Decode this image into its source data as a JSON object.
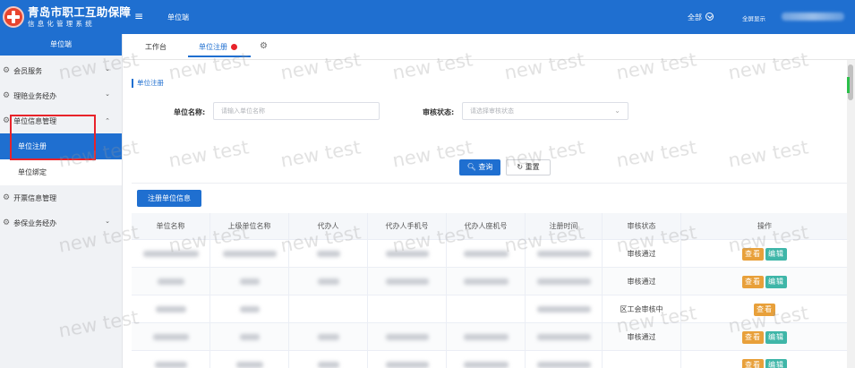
{
  "colors": {
    "primary": "#1f6fd0",
    "danger": "#e8232a",
    "view_btn": "#e8a03a",
    "edit_btn": "#3fb6a8"
  },
  "header": {
    "logo_title": "青岛市职工互助保障",
    "logo_subtitle": "信息化管理系统",
    "menu_icon": "menu-icon",
    "page_title": "单位端",
    "all_label": "全部",
    "fullscreen_label": "全屏显示"
  },
  "sidebar": {
    "title": "单位端",
    "items": [
      {
        "label": "会员服务",
        "icon": "gear-icon",
        "chevron": "chevron-down-icon"
      },
      {
        "label": "理赔业务经办",
        "icon": "gear-icon",
        "chevron": "chevron-down-icon"
      },
      {
        "label": "单位信息管理",
        "icon": "gear-icon",
        "chevron": "chevron-up-icon",
        "children": [
          {
            "label": "单位注册",
            "active": true
          },
          {
            "label": "单位绑定"
          }
        ]
      },
      {
        "label": "开票信息管理",
        "icon": "gear-icon"
      },
      {
        "label": "参保业务经办",
        "icon": "gear-icon",
        "chevron": "chevron-down-icon"
      }
    ]
  },
  "tabs": [
    {
      "label": "工作台"
    },
    {
      "label": "单位注册",
      "active": true
    }
  ],
  "section_title": "单位注册",
  "search": {
    "name_label": "单位名称:",
    "name_placeholder": "请输入单位名称",
    "status_label": "审核状态:",
    "status_placeholder": "请选择审核状态",
    "search_button": "查询",
    "reset_button": "重置"
  },
  "register_button": "注册单位信息",
  "table": {
    "columns": [
      "单位名称",
      "上级单位名称",
      "代办人",
      "代办人手机号",
      "代办人座机号",
      "注册时间",
      "审核状态",
      "操作"
    ],
    "rows": [
      {
        "status": "审核通过",
        "actions": [
          "查看",
          "编辑"
        ]
      },
      {
        "status": "审核通过",
        "actions": [
          "查看",
          "编辑"
        ]
      },
      {
        "status": "区工会审核中",
        "actions": [
          "查看"
        ]
      },
      {
        "status": "审核通过",
        "actions": [
          "查看",
          "编辑"
        ]
      },
      {
        "status": "",
        "actions": [
          "查看",
          "编辑"
        ]
      }
    ]
  },
  "watermark": "new test"
}
